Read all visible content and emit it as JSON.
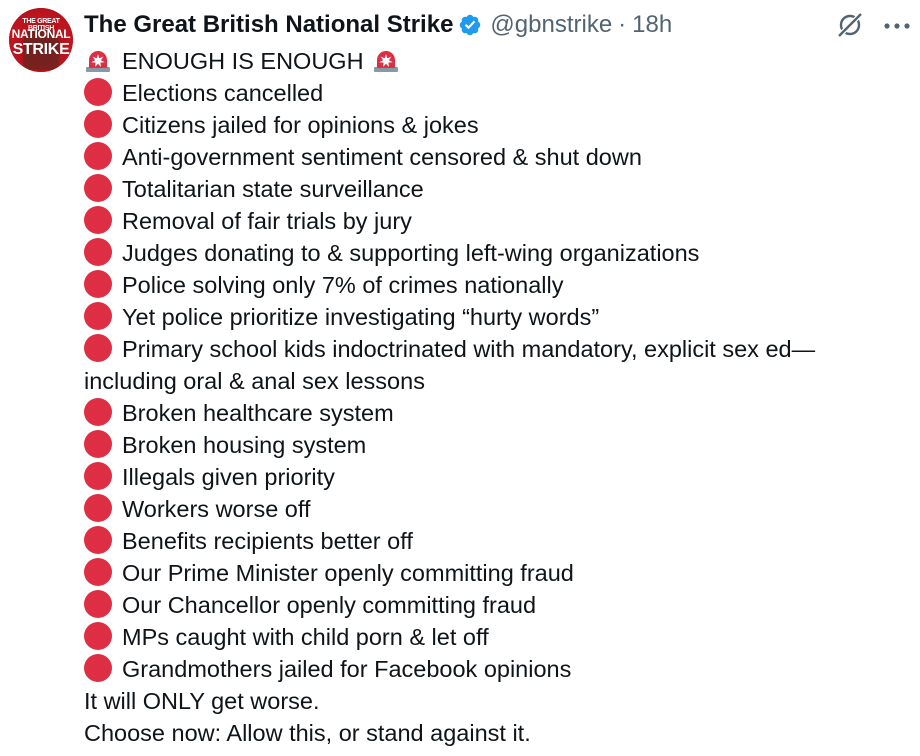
{
  "author": {
    "display_name": "The Great British National Strike",
    "handle": "@gbnstrike",
    "separator": "·",
    "time": "18h",
    "avatar_text": [
      "THE GREAT BRITISH",
      "NATIONAL",
      "STRIKE"
    ],
    "verified": true
  },
  "colors": {
    "verified_blue": "#1d9bf0",
    "bullet_red": "#dd2e44",
    "muted_gray": "#536471",
    "text": "#0f1419"
  },
  "icons": {
    "header_actions": [
      "grok-icon",
      "more-icon"
    ],
    "bullet": "red-circle-emoji",
    "headline": "police-light-emoji"
  },
  "tweet": {
    "headline": "ENOUGH IS ENOUGH",
    "items": [
      "Elections cancelled",
      "Citizens jailed for opinions & jokes",
      "Anti-government sentiment censored & shut down",
      "Totalitarian state surveillance",
      "Removal of fair trials by jury",
      "Judges donating to & supporting left-wing organizations",
      "Police solving only 7% of crimes nationally",
      "Yet police prioritize investigating “hurty words”",
      "Primary school kids indoctrinated with mandatory, explicit sex ed— including oral & anal sex lessons",
      "Broken healthcare system",
      "Broken housing system",
      "Illegals given priority",
      "Workers worse off",
      "Benefits recipients better off",
      "Our Prime Minister openly committing fraud",
      "Our Chancellor openly committing fraud",
      "MPs caught with child porn & let off",
      "Grandmothers jailed for Facebook opinions"
    ],
    "closing": [
      "It will ONLY get worse.",
      "Choose now: Allow this, or stand against it."
    ]
  }
}
